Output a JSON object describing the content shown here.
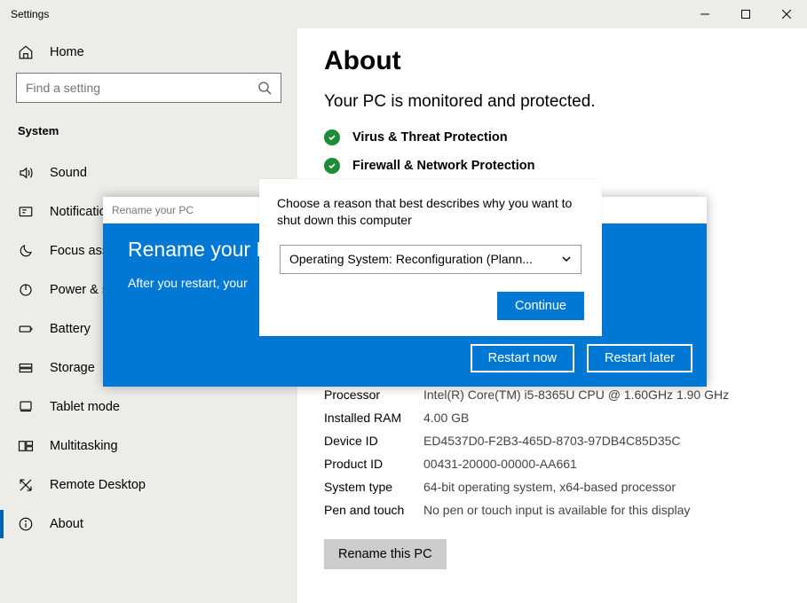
{
  "window": {
    "title": "Settings"
  },
  "sidebar": {
    "home_label": "Home",
    "search_placeholder": "Find a setting",
    "section_label": "System",
    "items": [
      {
        "label": "Sound"
      },
      {
        "label": "Notifications"
      },
      {
        "label": "Focus assist"
      },
      {
        "label": "Power & sleep"
      },
      {
        "label": "Battery"
      },
      {
        "label": "Storage"
      },
      {
        "label": "Tablet mode"
      },
      {
        "label": "Multitasking"
      },
      {
        "label": "Remote Desktop"
      },
      {
        "label": "About"
      }
    ]
  },
  "content": {
    "title": "About",
    "subtitle": "Your PC is monitored and protected.",
    "status": [
      "Virus & Threat Protection",
      "Firewall & Network Protection"
    ],
    "specs": [
      {
        "k": "Processor",
        "v": "Intel(R) Core(TM) i5-8365U CPU @ 1.60GHz   1.90 GHz"
      },
      {
        "k": "Installed RAM",
        "v": "4.00 GB"
      },
      {
        "k": "Device ID",
        "v": "ED4537D0-F2B3-465D-8703-97DB4C85D35C"
      },
      {
        "k": "Product ID",
        "v": "00431-20000-00000-AA661"
      },
      {
        "k": "System type",
        "v": "64-bit operating system, x64-based processor"
      },
      {
        "k": "Pen and touch",
        "v": "No pen or touch input is available for this display"
      }
    ],
    "rename_button": "Rename this PC"
  },
  "rename_dialog": {
    "tab_title": "Rename your PC",
    "heading": "Rename your P",
    "message": "After you restart, your",
    "restart_now": "Restart now",
    "restart_later": "Restart later"
  },
  "reason_dialog": {
    "message": "Choose a reason that best describes why you want to shut down this computer",
    "selected": "Operating System: Reconfiguration (Plann...",
    "continue": "Continue"
  }
}
